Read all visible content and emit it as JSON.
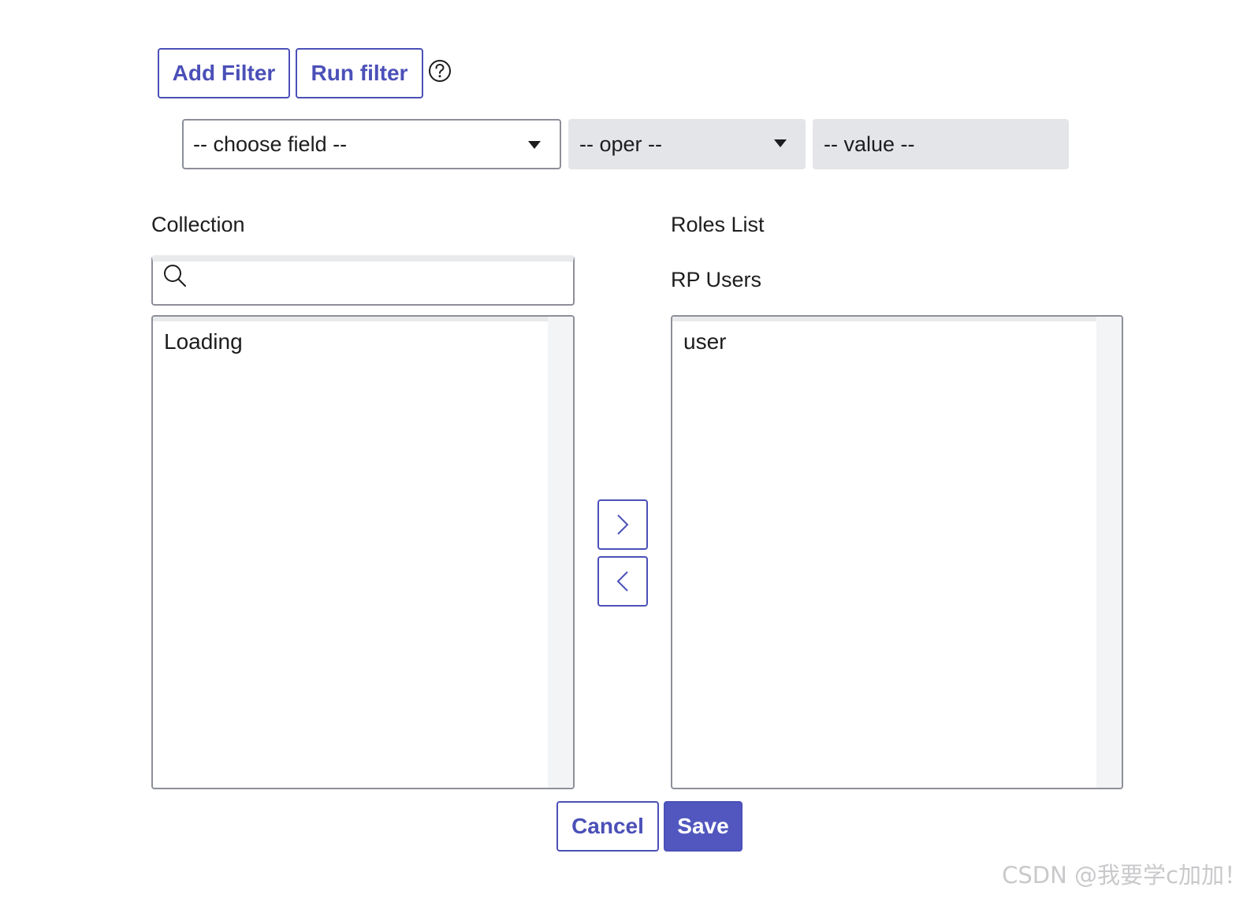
{
  "toolbar": {
    "add_filter_label": "Add Filter",
    "run_filter_label": "Run filter",
    "help_icon": "question-circle-icon"
  },
  "filter": {
    "field_placeholder": "-- choose field --",
    "oper_placeholder": "-- oper --",
    "value_placeholder": "-- value --"
  },
  "collection": {
    "title": "Collection",
    "search_placeholder": "",
    "items": [
      "Loading"
    ]
  },
  "roles": {
    "title": "Roles List",
    "subtitle": "RP Users",
    "items": [
      "user"
    ]
  },
  "actions": {
    "cancel_label": "Cancel",
    "save_label": "Save"
  },
  "watermark": "CSDN @我要学c加加！",
  "colors": {
    "accent": "#4b50b8",
    "save_bg": "#5257bf"
  }
}
